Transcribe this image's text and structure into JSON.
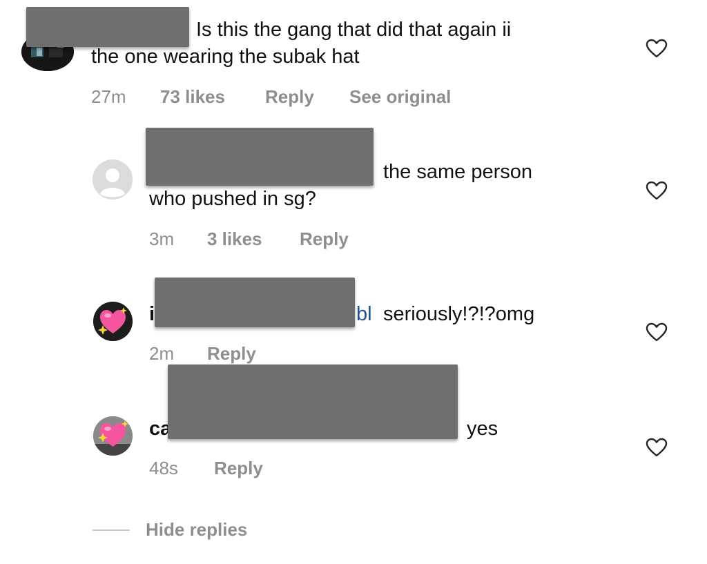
{
  "comments": [
    {
      "text_line1": "Is this the gang that did that again ii",
      "text_line2": "the one wearing the subak hat",
      "time": "27m",
      "likes": "73 likes",
      "reply": "Reply",
      "see_original": "See original"
    },
    {
      "text_line1": "the same person",
      "text_line2": "who pushed in sg?",
      "time": "3m",
      "likes": "3 likes",
      "reply": "Reply"
    },
    {
      "prefix": "i",
      "mention_tail": "bl",
      "text": "seriously!?!?omg",
      "time": "2m",
      "reply": "Reply"
    },
    {
      "prefix": "ca",
      "text": "yes",
      "time": "48s",
      "reply": "Reply"
    }
  ],
  "hide_replies": "Hide replies",
  "colors": {
    "meta_gray": "#8e8e8e",
    "redaction_gray": "#6f6f6f",
    "mention_blue": "#1f4e8c"
  },
  "icons": {
    "like": "heart-outline-icon",
    "default_avatar": "default-person-avatar"
  }
}
